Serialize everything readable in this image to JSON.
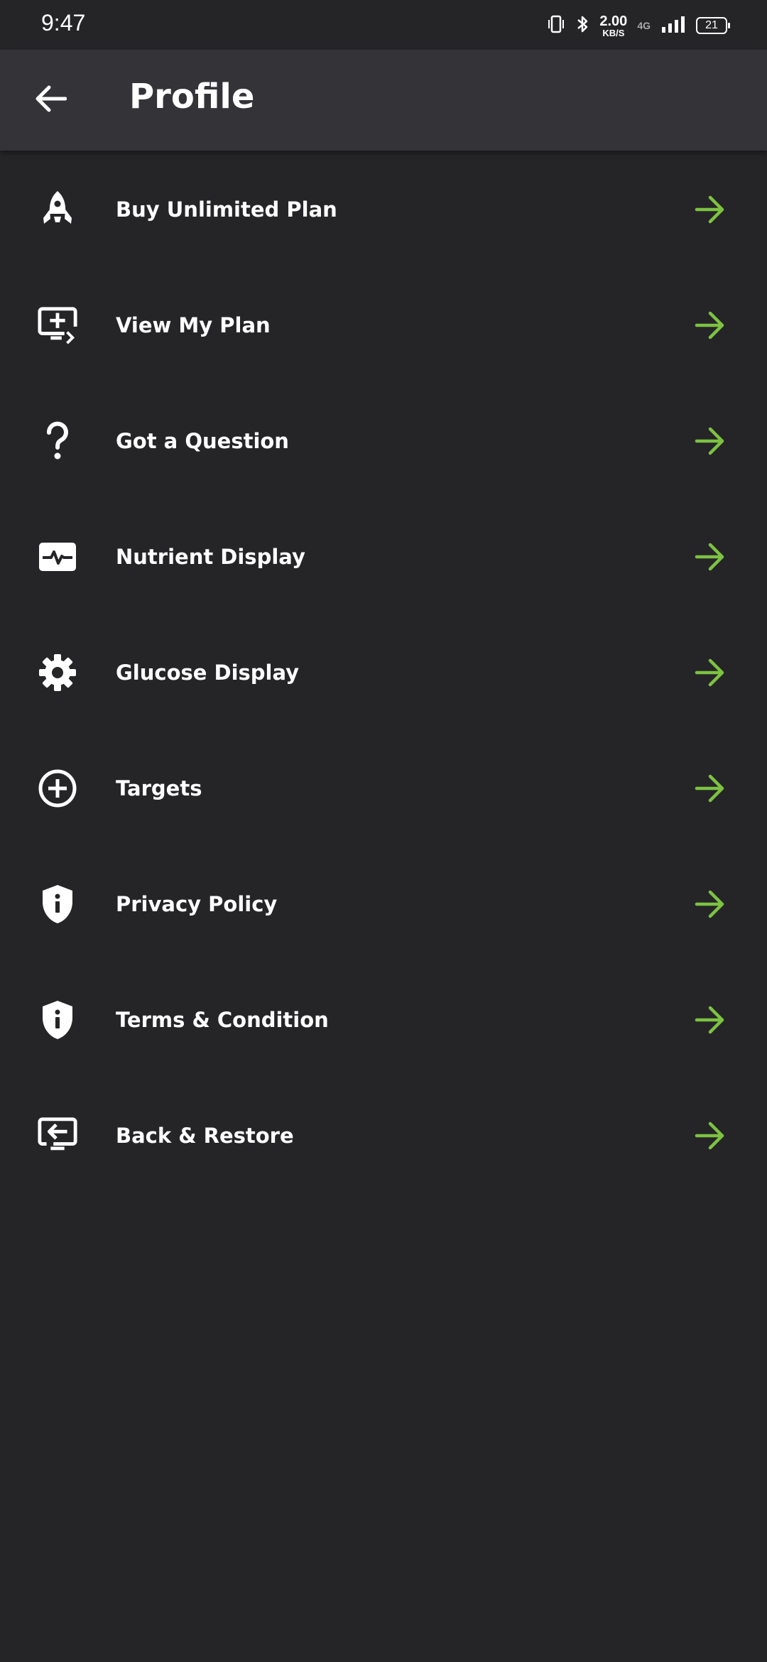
{
  "status_bar": {
    "time": "9:47",
    "speed_value": "2.00",
    "speed_unit": "KB/S",
    "network": "4G",
    "battery": "21"
  },
  "header": {
    "title": "Profile",
    "back_icon": "arrow-left-icon"
  },
  "colors": {
    "background": "#252528",
    "app_bar": "#333338",
    "accent_arrow": "#7dc242",
    "text": "#ffffff"
  },
  "menu": {
    "items": [
      {
        "label": "Buy Unlimited Plan",
        "icon": "rocket-icon"
      },
      {
        "label": "View My Plan",
        "icon": "monitor-plus-icon"
      },
      {
        "label": "Got a Question",
        "icon": "question-icon"
      },
      {
        "label": "Nutrient Display",
        "icon": "heartbeat-icon"
      },
      {
        "label": "Glucose Display",
        "icon": "gear-icon"
      },
      {
        "label": "Targets",
        "icon": "plus-circle-icon"
      },
      {
        "label": "Privacy Policy",
        "icon": "shield-info-icon"
      },
      {
        "label": "Terms & Condition",
        "icon": "shield-info-icon"
      },
      {
        "label": "Back & Restore",
        "icon": "monitor-restore-icon"
      }
    ],
    "row_arrow_icon": "arrow-right-icon"
  }
}
